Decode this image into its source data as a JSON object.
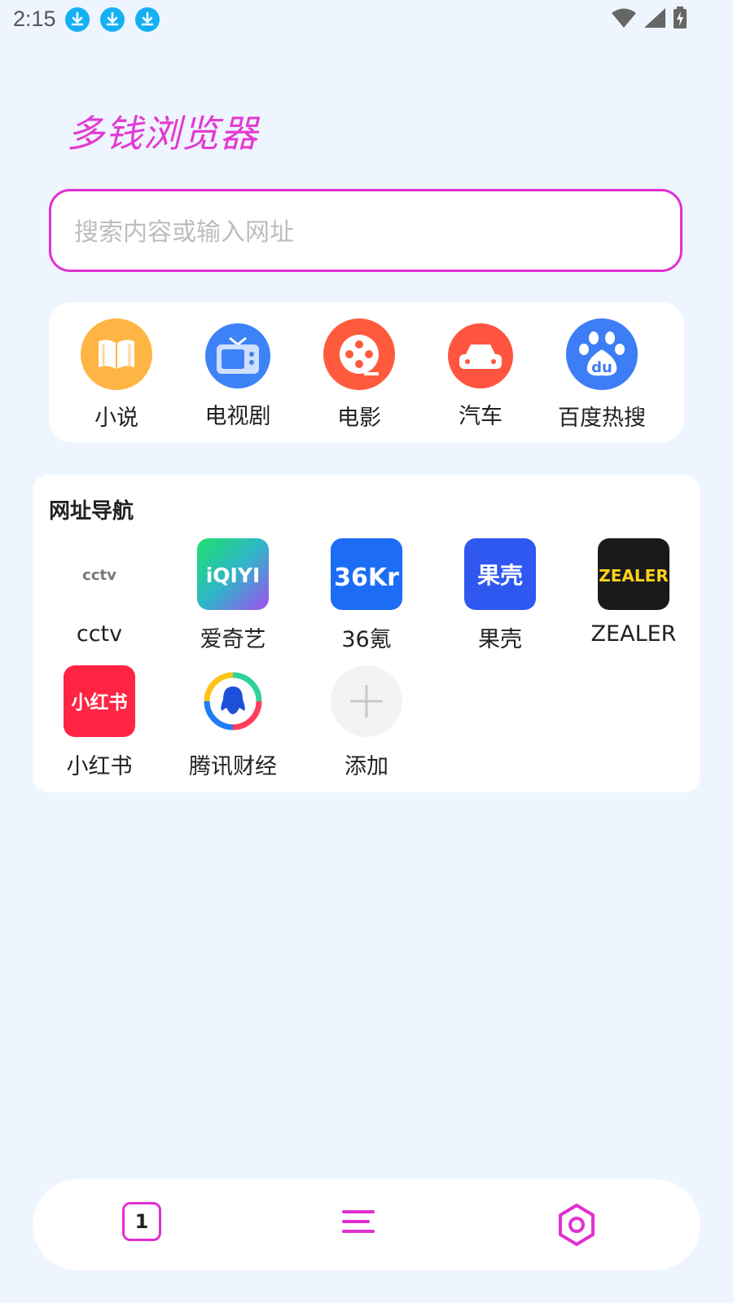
{
  "status_bar": {
    "time": "2:15",
    "notification_icons": [
      "download-icon",
      "download-icon",
      "download-icon"
    ],
    "right_icons": [
      "wifi-icon",
      "cell-signal-icon",
      "battery-charging-icon"
    ]
  },
  "app": {
    "logo": "多钱浏览器"
  },
  "search": {
    "placeholder": "搜索内容或输入网址"
  },
  "quick_links": [
    {
      "label": "小说",
      "icon": "book-icon",
      "color": "#ffb544"
    },
    {
      "label": "电视剧",
      "icon": "tv-icon",
      "color": "#3d82f6"
    },
    {
      "label": "电影",
      "icon": "film-reel-icon",
      "color": "#ff5a3c"
    },
    {
      "label": "汽车",
      "icon": "car-icon",
      "color": "#ff5440"
    },
    {
      "label": "百度热搜",
      "icon": "baidu-paw-icon",
      "color": "#3d7df5"
    }
  ],
  "nav": {
    "title": "网址导航",
    "items": [
      {
        "label": "cctv",
        "icon_text": "cctv"
      },
      {
        "label": "爱奇艺",
        "icon_text": "iQIYI"
      },
      {
        "label": "36氪",
        "icon_text": "36Kr"
      },
      {
        "label": "果壳",
        "icon_text": "果壳"
      },
      {
        "label": "ZEALER",
        "icon_text": "ZEALER"
      },
      {
        "label": "小红书",
        "icon_text": "小红书"
      },
      {
        "label": "腾讯财经",
        "icon": "tencent-finance-icon"
      },
      {
        "label": "添加",
        "icon": "plus-icon"
      }
    ]
  },
  "bottom_bar": {
    "tab_count": "1",
    "accent": "#e22fd2"
  }
}
